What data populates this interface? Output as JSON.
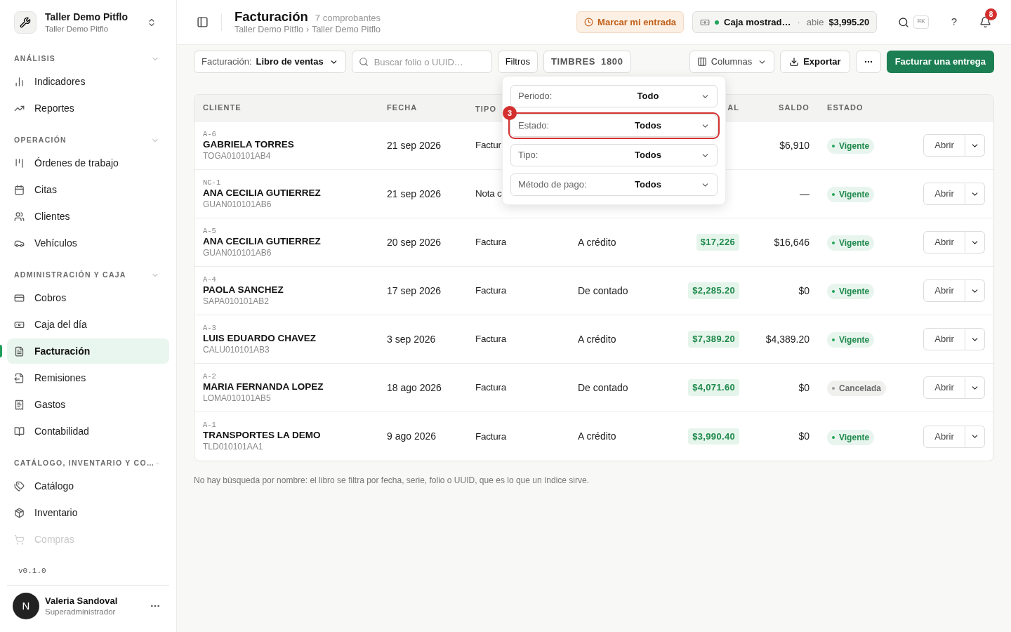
{
  "workspace": {
    "name": "Taller Demo Pitflo",
    "subtitle": "Taller Demo Pitflo"
  },
  "sidebar": {
    "sections": [
      {
        "title": "ANÁLISIS",
        "items": [
          {
            "label": "Indicadores",
            "selected": false,
            "faded": false
          },
          {
            "label": "Reportes",
            "selected": false,
            "faded": false
          }
        ]
      },
      {
        "title": "OPERACIÓN",
        "items": [
          {
            "label": "Órdenes de trabajo",
            "selected": false,
            "faded": false
          },
          {
            "label": "Citas",
            "selected": false,
            "faded": false
          },
          {
            "label": "Clientes",
            "selected": false,
            "faded": false
          },
          {
            "label": "Vehículos",
            "selected": false,
            "faded": false
          }
        ]
      },
      {
        "title": "ADMINISTRACIÓN Y CAJA",
        "items": [
          {
            "label": "Cobros",
            "selected": false,
            "faded": false
          },
          {
            "label": "Caja del día",
            "selected": false,
            "faded": false
          },
          {
            "label": "Facturación",
            "selected": true,
            "faded": false
          },
          {
            "label": "Remisiones",
            "selected": false,
            "faded": false
          },
          {
            "label": "Gastos",
            "selected": false,
            "faded": false
          },
          {
            "label": "Contabilidad",
            "selected": false,
            "faded": false
          }
        ]
      },
      {
        "title": "CATÁLOGO, INVENTARIO Y CO…",
        "items": [
          {
            "label": "Catálogo",
            "selected": false,
            "faded": false
          },
          {
            "label": "Inventario",
            "selected": false,
            "faded": false
          },
          {
            "label": "Compras",
            "selected": false,
            "faded": true
          }
        ]
      }
    ],
    "version": "v0.1.0",
    "user": {
      "initial": "N",
      "name": "Valeria Sandoval",
      "role": "Superadministrador"
    }
  },
  "header": {
    "title": "Facturación",
    "count": "7 comprobantes",
    "breadcrumb": [
      "Taller Demo Pitflo",
      "›",
      "Taller Demo Pitflo"
    ],
    "check_in": "Marcar mi entrada",
    "register": {
      "name": "Caja mostrad…",
      "separator": "·",
      "status": "abie",
      "amount": "$3,995.20"
    },
    "shortcut": "⌘K",
    "help": "?",
    "notifications": "8"
  },
  "toolbar": {
    "view_label": "Facturación:",
    "view_value": "Libro de ventas",
    "search_placeholder": "Buscar folio o UUID…",
    "filters": "Filtros",
    "stamps": [
      "TIMBRES",
      "1800"
    ],
    "columns": "Columnas",
    "export": "Exportar",
    "primary": "Facturar una entrega"
  },
  "filters_popover": {
    "marker": "3",
    "fields": [
      {
        "label": "Periodo:",
        "value": "Todo",
        "highlighted": false
      },
      {
        "label": "Estado:",
        "value": "Todos",
        "highlighted": true
      },
      {
        "label": "Tipo:",
        "value": "Todos",
        "highlighted": false
      },
      {
        "label": "Método de pago:",
        "value": "Todos",
        "highlighted": false
      }
    ]
  },
  "table": {
    "columns": [
      "CLIENTE",
      "FECHA",
      "TIPO",
      "AL",
      "SALDO",
      "ESTADO"
    ],
    "rows": [
      {
        "folio": "A-6",
        "client": "GABRIELA TORRES",
        "rfc": "TOGA010101AB4",
        "date": "21 sep 2026",
        "type": "Factur",
        "saldo": "$6,910",
        "status": "Vigente",
        "kind": "active",
        "action": "Abrir"
      },
      {
        "folio": "NC-1",
        "client": "ANA CECILIA GUTIERREZ",
        "rfc": "GUAN010101AB6",
        "date": "21 sep 2026",
        "type": "Nota c",
        "saldo": "—",
        "status": "Vigente",
        "kind": "active",
        "action": "Abrir"
      },
      {
        "folio": "A-5",
        "client": "ANA CECILIA GUTIERREZ",
        "rfc": "GUAN010101AB6",
        "date": "20 sep 2026",
        "type": "Factura",
        "method": "A crédito",
        "total": "$17,226",
        "saldo": "$16,646",
        "status": "Vigente",
        "kind": "active",
        "action": "Abrir"
      },
      {
        "folio": "A-4",
        "client": "PAOLA SANCHEZ",
        "rfc": "SAPA010101AB2",
        "date": "17 sep 2026",
        "type": "Factura",
        "method": "De contado",
        "total": "$2,285.20",
        "saldo": "$0",
        "status": "Vigente",
        "kind": "active",
        "action": "Abrir"
      },
      {
        "folio": "A-3",
        "client": "LUIS EDUARDO CHAVEZ",
        "rfc": "CALU010101AB3",
        "date": "3 sep 2026",
        "type": "Factura",
        "method": "A crédito",
        "total": "$7,389.20",
        "saldo": "$4,389.20",
        "status": "Vigente",
        "kind": "active",
        "action": "Abrir"
      },
      {
        "folio": "A-2",
        "client": "MARIA FERNANDA LOPEZ",
        "rfc": "LOMA010101AB5",
        "date": "18 ago 2026",
        "type": "Factura",
        "method": "De contado",
        "total": "$4,071.60",
        "saldo": "$0",
        "status": "Cancelada",
        "kind": "cancelled",
        "action": "Abrir"
      },
      {
        "folio": "A-1",
        "client": "TRANSPORTES LA DEMO",
        "rfc": "TLD010101AA1",
        "date": "9 ago 2026",
        "type": "Factura",
        "method": "A crédito",
        "total": "$3,990.40",
        "saldo": "$0",
        "status": "Vigente",
        "kind": "active",
        "action": "Abrir"
      }
    ]
  },
  "footnote": "No hay búsqueda por nombre: el libro se filtra por fecha, serie, folio o UUID, que es lo que un índice sirve."
}
